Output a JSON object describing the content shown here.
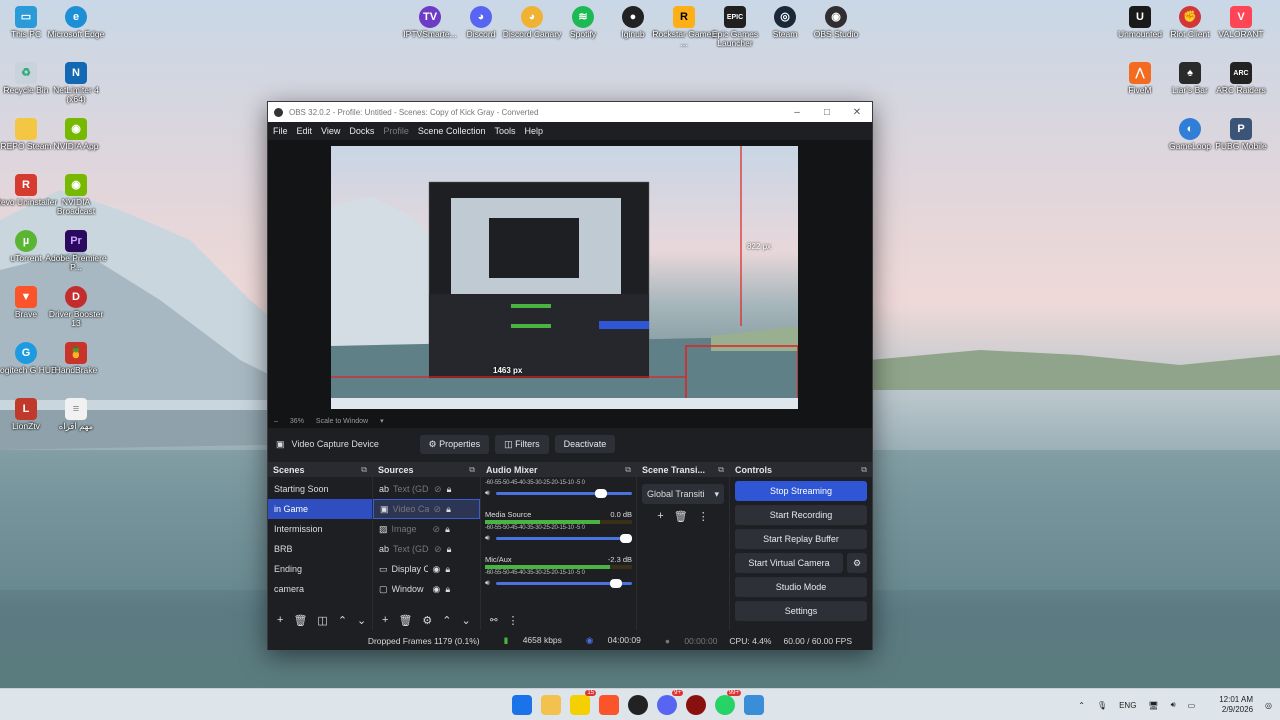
{
  "desktop": {
    "left_icons": [
      {
        "label": "This PC",
        "icon": "monitor-icon",
        "color": "#2b9ad9"
      },
      {
        "label": "Microsoft Edge",
        "icon": "edge-icon",
        "color": "#1c8fd6"
      },
      {
        "label": "Recycle Bin",
        "icon": "recycle-bin-icon",
        "color": "#c9d3dc"
      },
      {
        "label": "NetLimiter 4 (x64)",
        "icon": "netlimiter-icon",
        "color": "#1268b3"
      },
      {
        "label": "REPO Steam",
        "icon": "folder-icon",
        "color": "#f3c744"
      },
      {
        "label": "NVIDIA App",
        "icon": "nvidia-icon",
        "color": "#76b900"
      },
      {
        "label": "Revo Uninstaller",
        "icon": "revo-icon",
        "color": "#d63b2f"
      },
      {
        "label": "NVIDIA Broadcast",
        "icon": "nvidia-icon",
        "color": "#76b900"
      },
      {
        "label": "uTorrent",
        "icon": "utorrent-icon",
        "color": "#5bb535"
      },
      {
        "label": "Adobe Premiere P...",
        "icon": "premiere-icon",
        "color": "#2a0a5e"
      },
      {
        "label": "Brave",
        "icon": "brave-icon",
        "color": "#fb542b"
      },
      {
        "label": "Driver Booster 13",
        "icon": "driver-booster-icon",
        "color": "#c42d2d"
      },
      {
        "label": "Logitech G HUB",
        "icon": "logitech-icon",
        "color": "#1d9be0"
      },
      {
        "label": "HandBrake",
        "icon": "handbrake-icon",
        "color": "#c9332a"
      },
      {
        "label": "LionZtv",
        "icon": "lionztv-icon",
        "color": "#c0392b"
      },
      {
        "label": "مهم اقراه",
        "icon": "document-icon",
        "color": "#f1f1f1"
      }
    ],
    "top_icons": [
      {
        "label": "IPTVSmarte...",
        "icon": "iptv-icon",
        "color": "#6c3cc4"
      },
      {
        "label": "Discord",
        "icon": "discord-icon",
        "color": "#5865f2"
      },
      {
        "label": "Discord Canary",
        "icon": "discord-canary-icon",
        "color": "#f0b232"
      },
      {
        "label": "Spotify",
        "icon": "spotify-icon",
        "color": "#1db954"
      },
      {
        "label": "Iginub",
        "icon": "github-icon",
        "color": "#222222"
      },
      {
        "label": "Rockstar Games ...",
        "icon": "rockstar-icon",
        "color": "#fcaf17"
      },
      {
        "label": "Epic Games Launcher",
        "icon": "epic-games-icon",
        "color": "#202020"
      },
      {
        "label": "Steam",
        "icon": "steam-icon",
        "color": "#1b2838"
      },
      {
        "label": "OBS Studio",
        "icon": "obs-icon",
        "color": "#302e31"
      }
    ],
    "right_icons": [
      {
        "label": "Unmounted",
        "icon": "unmounted-icon",
        "color": "#1a1a1a"
      },
      {
        "label": "Riot Client",
        "icon": "riot-icon",
        "color": "#d13639"
      },
      {
        "label": "VALORANT",
        "icon": "valorant-icon",
        "color": "#fd4556"
      },
      {
        "label": "FiveM",
        "icon": "fivem-icon",
        "color": "#f26b21"
      },
      {
        "label": "Liar's Bar",
        "icon": "liars-bar-icon",
        "color": "#2a2a2a"
      },
      {
        "label": "ARC Raiders",
        "icon": "arc-raiders-icon",
        "color": "#222222"
      },
      {
        "label": "GameLoop",
        "icon": "gameloop-icon",
        "color": "#2f7fd8"
      },
      {
        "label": "PUBG Mobile",
        "icon": "pubg-icon",
        "color": "#3a5577"
      }
    ]
  },
  "obs": {
    "title": "OBS 32.0.2 - Profile: Untitled - Scenes: Copy of Kick Gray - Converted",
    "menu": [
      "File",
      "Edit",
      "View",
      "Docks",
      "Profile",
      "Scene Collection",
      "Tools",
      "Help"
    ],
    "preview_labels": {
      "height": "822 px",
      "width": "1463 px"
    },
    "zoom": {
      "minus": "–",
      "value": "36%",
      "mode": "Scale to Window"
    },
    "source_bar": {
      "name": "Video Capture Device",
      "properties": "Properties",
      "filters": "Filters",
      "deactivate": "Deactivate"
    },
    "scenes": {
      "title": "Scenes",
      "items": [
        "Starting Soon",
        "in Game",
        "Intermission",
        "BRB",
        "Ending",
        "camera"
      ]
    },
    "sources": {
      "title": "Sources",
      "items": [
        {
          "label": "Text (GDI",
          "icon": "text-icon"
        },
        {
          "label": "Video Ca",
          "icon": "camera-icon"
        },
        {
          "label": "Image",
          "icon": "image-icon"
        },
        {
          "label": "Text (GDI",
          "icon": "text-icon"
        },
        {
          "label": "Display C",
          "icon": "display-icon"
        },
        {
          "label": "Window",
          "icon": "window-icon"
        }
      ]
    },
    "mixer": {
      "title": "Audio Mixer",
      "scale": "-60-55-50-45-40-35-30-25-20-15-10 -5 0",
      "tracks": [
        {
          "name": "",
          "db": ""
        },
        {
          "name": "Media Source",
          "db": "0.0 dB"
        },
        {
          "name": "Mic/Aux",
          "db": "-2.3 dB"
        }
      ],
      "levels": [
        0.0,
        0.78,
        0.85
      ],
      "volume": [
        0.82,
        1.0,
        0.93
      ]
    },
    "transitions": {
      "title": "Scene Transi...",
      "selected": "Global Transiti"
    },
    "controls": {
      "title": "Controls",
      "stop_streaming": "Stop Streaming",
      "start_recording": "Start Recording",
      "start_replay": "Start Replay Buffer",
      "start_virtual": "Start Virtual Camera",
      "studio_mode": "Studio Mode",
      "settings": "Settings"
    },
    "status": {
      "dropped": "Dropped Frames 1179 (0.1%)",
      "bitrate": "4658 kbps",
      "stream_time": "04:00:09",
      "rec_time": "00:00:00",
      "cpu": "CPU: 4.4%",
      "fps": "60.00 / 60.00 FPS"
    }
  },
  "taskbar": {
    "icons": [
      {
        "icon": "windows-start-icon",
        "color": "#1a73e8",
        "badge": ""
      },
      {
        "icon": "file-explorer-icon",
        "color": "#f2c14e",
        "badge": ""
      },
      {
        "icon": "lightning-app-icon",
        "color": "#f5d000",
        "badge": "15"
      },
      {
        "icon": "brave-icon",
        "color": "#fb542b",
        "badge": ""
      },
      {
        "icon": "github-icon",
        "color": "#222222",
        "badge": ""
      },
      {
        "icon": "discord-icon",
        "color": "#5865f2",
        "badge": "9+"
      },
      {
        "icon": "obs-icon",
        "color": "#8a1010",
        "badge": ""
      },
      {
        "icon": "whatsapp-icon",
        "color": "#25d366",
        "badge": "99+"
      },
      {
        "icon": "photos-icon",
        "color": "#3a8ed8",
        "badge": ""
      }
    ],
    "language": "ENG",
    "time": "12:01 AM",
    "date": "2/9/2026"
  }
}
